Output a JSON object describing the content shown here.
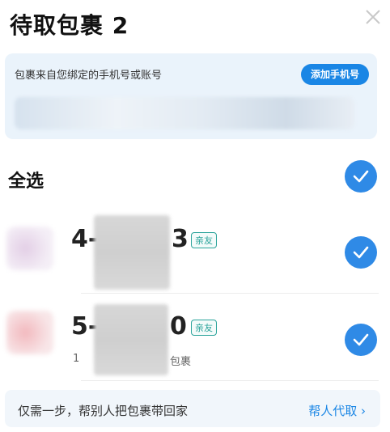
{
  "header": {
    "title": "待取包裹 2"
  },
  "bound_accounts": {
    "description": "包裹来自您绑定的手机号或账号",
    "add_button_label": "添加手机号"
  },
  "select_all": {
    "label": "全选"
  },
  "packages": [
    {
      "code_prefix": "4-",
      "code_suffix": "3",
      "tag": "亲友",
      "sub_prefix": "",
      "sub_suffix": ""
    },
    {
      "code_prefix": "5-",
      "code_suffix": "0",
      "tag": "亲友",
      "sub_prefix": "1",
      "sub_suffix": "包裹"
    }
  ],
  "footer": {
    "text": "仅需一步，帮别人把包裹带回家",
    "link_label": "帮人代取"
  },
  "colors": {
    "accent": "#2f8ae6",
    "tag": "#2aa39a"
  }
}
